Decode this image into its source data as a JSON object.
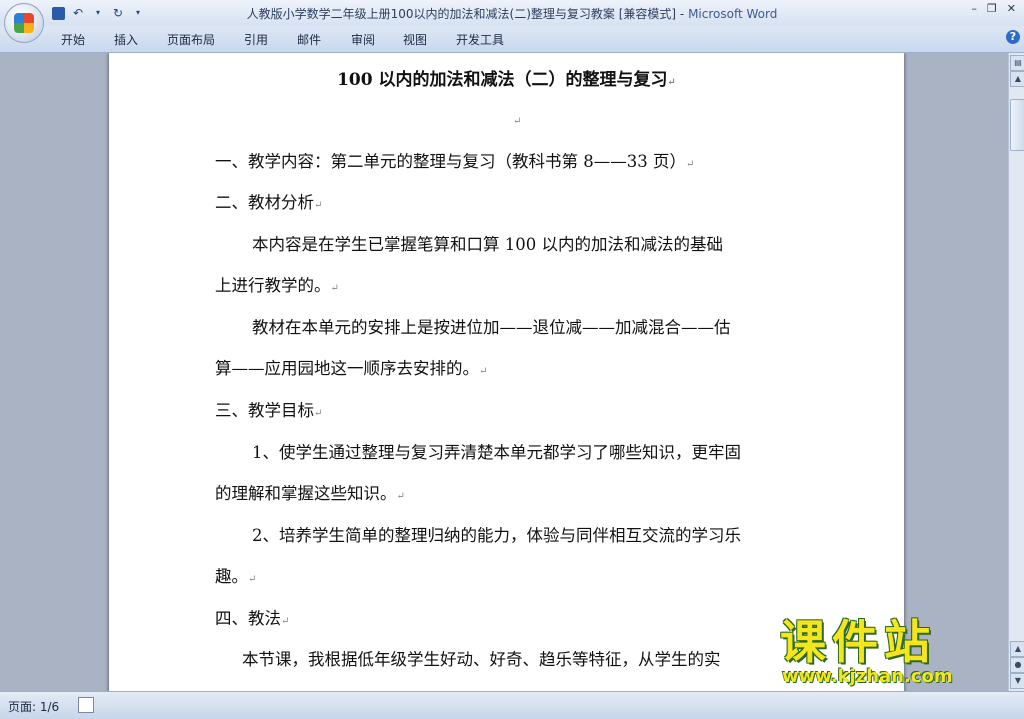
{
  "window": {
    "title": "人教版小学数学二年级上册100以内的加法和减法(二)整理与复习教案 [兼容模式]",
    "app_name": "Microsoft Word",
    "separator": " - "
  },
  "quick_access": {
    "save_icon": "save-icon",
    "undo_icon": "undo-icon",
    "redo_icon": "redo-icon"
  },
  "ribbon": {
    "tabs": [
      "开始",
      "插入",
      "页面布局",
      "引用",
      "邮件",
      "审阅",
      "视图",
      "开发工具"
    ]
  },
  "document": {
    "title": "100 以内的加法和减法（二）的整理与复习",
    "paragraph_mark": "↵",
    "lines": [
      "一、教学内容：第二单元的整理与复习（教科书第 8——33 页）",
      "二、教材分析",
      "本内容是在学生已掌握笔算和口算 100  以内的加法和减法的基础",
      "上进行教学的。",
      "教材在本单元的安排上是按进位加——退位减——加减混合——估",
      "算——应用园地这一顺序去安排的。",
      "三、教学目标",
      "1、使学生通过整理与复习弄清楚本单元都学习了哪些知识，更牢固",
      "的理解和掌握这些知识。",
      "2、培养学生简单的整理归纳的能力，体验与同伴相互交流的学习乐",
      "趣。",
      "四、教法",
      "本节课，我根据低年级学生好动、好奇、趋乐等特征，从学生的实"
    ]
  },
  "status_bar": {
    "page": "页面: 1/6"
  },
  "watermark": {
    "text": "课件站",
    "url": "www.kjzhan.com"
  }
}
